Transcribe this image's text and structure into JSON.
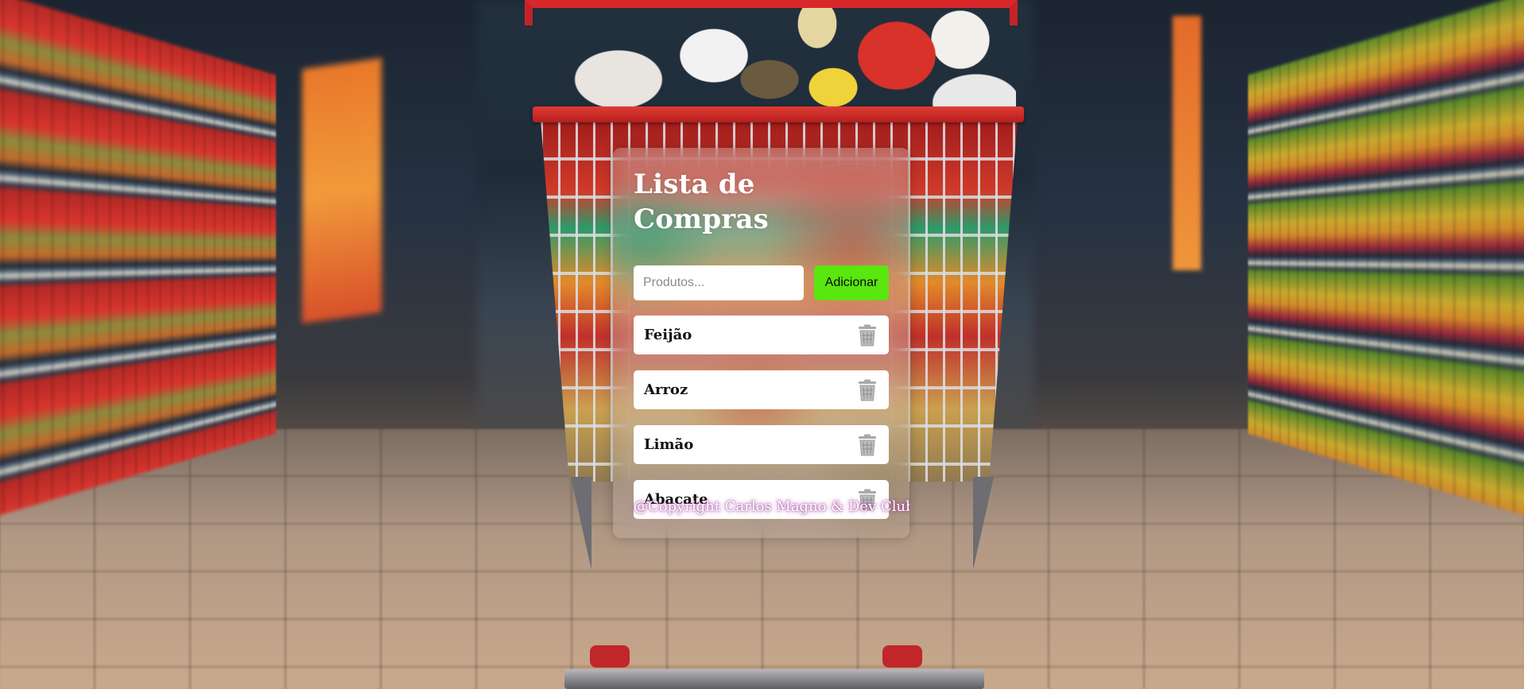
{
  "app": {
    "title": "Lista de Compras"
  },
  "form": {
    "input_placeholder": "Produtos...",
    "input_value": "",
    "add_label": "Adicionar"
  },
  "items": [
    {
      "label": "Feijão"
    },
    {
      "label": "Arroz"
    },
    {
      "label": "Limão"
    },
    {
      "label": "Abacate"
    }
  ],
  "footer": {
    "copyright": "@Copyright Carlos Magno & Dev Club"
  },
  "icons": {
    "delete": "trash-icon"
  },
  "colors": {
    "add_button": "#5ae60f",
    "item_background": "#ffffff",
    "title_text": "#ffffff",
    "copyright_glow": "#aa28a0"
  }
}
